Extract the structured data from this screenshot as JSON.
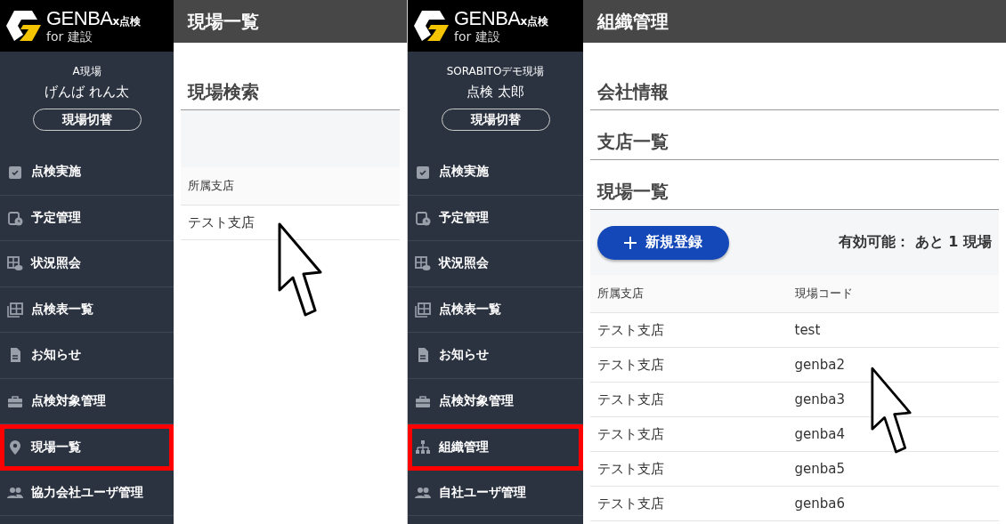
{
  "panels": [
    {
      "brand": {
        "name": "GENBA",
        "suffix": "x点検",
        "sub": "for 建設"
      },
      "user": {
        "site": "A現場",
        "name": "げんば れん太",
        "switch_button": "現場切替"
      },
      "menu": [
        {
          "label": "点検実施",
          "highlighted": false
        },
        {
          "label": "予定管理",
          "highlighted": false
        },
        {
          "label": "状況照会",
          "highlighted": false
        },
        {
          "label": "点検表一覧",
          "highlighted": false
        },
        {
          "label": "お知らせ",
          "highlighted": false
        },
        {
          "label": "点検対象管理",
          "highlighted": false
        },
        {
          "label": "現場一覧",
          "highlighted": true
        },
        {
          "label": "協力会社ユーザ管理",
          "highlighted": false
        }
      ],
      "main": {
        "title": "現場一覧",
        "sections": [
          "現場検索"
        ],
        "table": {
          "columns": [
            "所属支店"
          ],
          "rows": [
            [
              "テスト支店"
            ]
          ]
        }
      }
    },
    {
      "brand": {
        "name": "GENBA",
        "suffix": "x点検",
        "sub": "for 建設"
      },
      "user": {
        "site": "SORABITOデモ現場",
        "name": "点検 太郎",
        "switch_button": "現場切替"
      },
      "menu": [
        {
          "label": "点検実施",
          "highlighted": false
        },
        {
          "label": "予定管理",
          "highlighted": false
        },
        {
          "label": "状況照会",
          "highlighted": false
        },
        {
          "label": "点検表一覧",
          "highlighted": false
        },
        {
          "label": "お知らせ",
          "highlighted": false
        },
        {
          "label": "点検対象管理",
          "highlighted": false
        },
        {
          "label": "組織管理",
          "highlighted": true
        },
        {
          "label": "自社ユーザ管理",
          "highlighted": false
        }
      ],
      "main": {
        "title": "組織管理",
        "sections": [
          "会社情報",
          "支店一覧",
          "現場一覧"
        ],
        "toolbar": {
          "button": "新規登録",
          "quota": "有効可能： あと 1 現場"
        },
        "table": {
          "columns": [
            "所属支店",
            "現場コード"
          ],
          "rows": [
            [
              "テスト支店",
              "test"
            ],
            [
              "テスト支店",
              "genba2"
            ],
            [
              "テスト支店",
              "genba3"
            ],
            [
              "テスト支店",
              "genba4"
            ],
            [
              "テスト支店",
              "genba5"
            ],
            [
              "テスト支店",
              "genba6"
            ]
          ]
        }
      }
    }
  ]
}
